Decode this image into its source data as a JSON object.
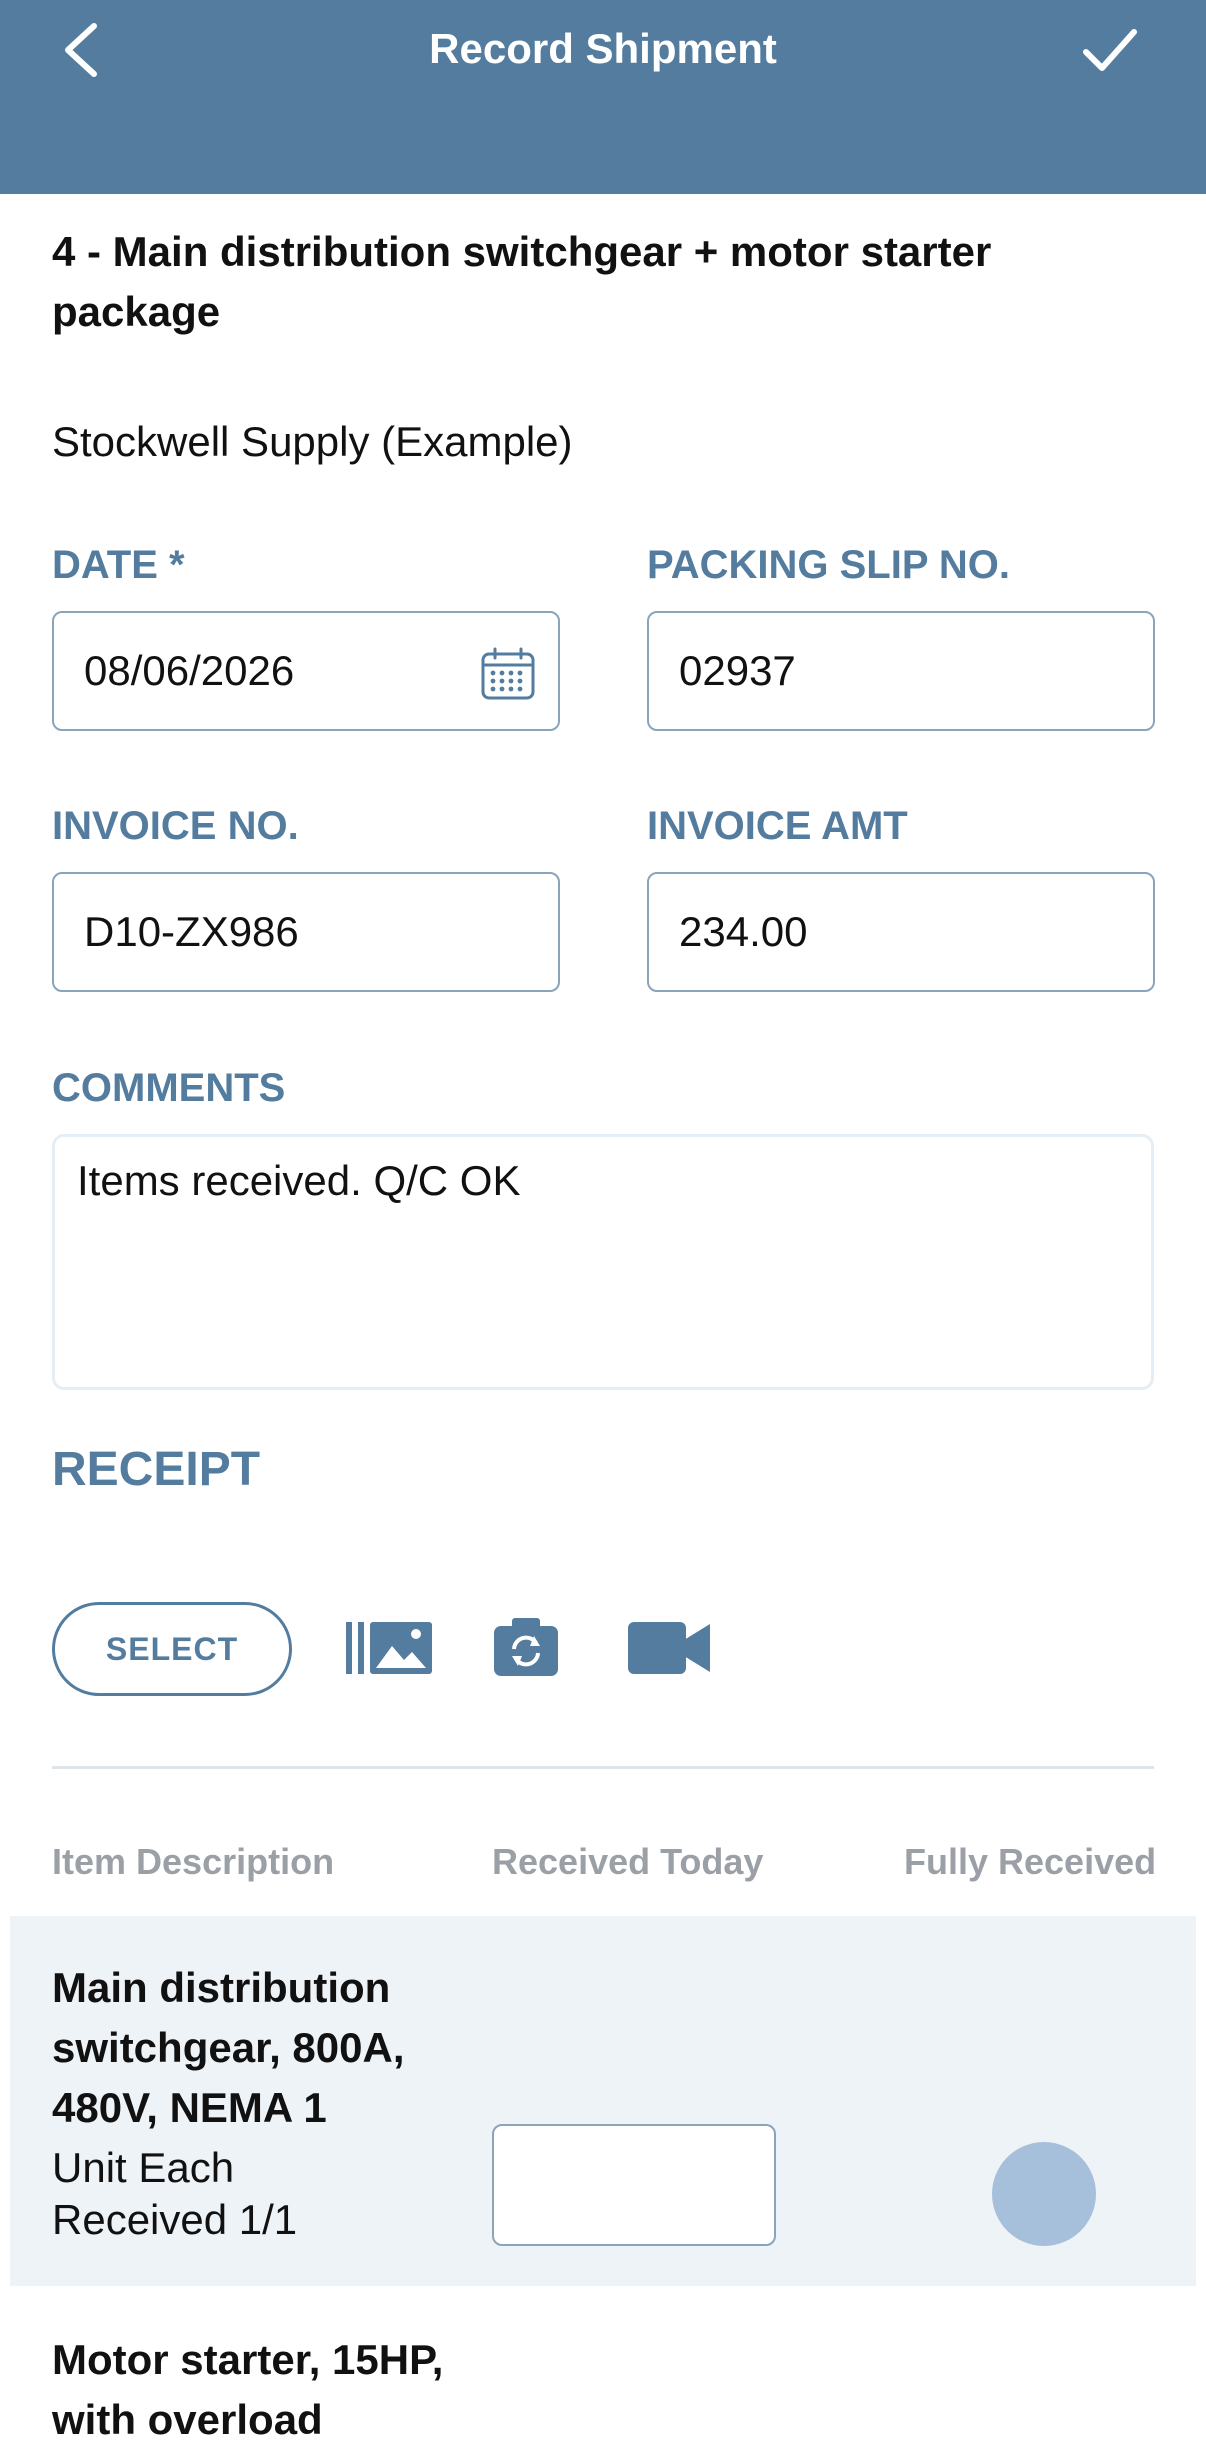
{
  "header": {
    "title": "Record Shipment",
    "back_icon": "chevron-left-icon",
    "save_icon": "check-icon",
    "background_color": "#537c9e"
  },
  "job": {
    "title": "4 - Main distribution switchgear + motor starter package",
    "vendor": "Stockwell Supply (Example)"
  },
  "form": {
    "date": {
      "label": "DATE *",
      "value": "08/06/2026"
    },
    "packing_slip": {
      "label": "PACKING SLIP NO.",
      "value": "02937"
    },
    "invoice_no": {
      "label": "INVOICE NO.",
      "value": "D10-ZX986"
    },
    "invoice_amt": {
      "label": "INVOICE AMT",
      "value": "234.00"
    },
    "comments": {
      "label": "COMMENTS",
      "value": "Items received. Q/C OK"
    }
  },
  "receipt": {
    "label": "RECEIPT",
    "select_label": "SELECT",
    "icons": [
      "gallery-icon",
      "camera-icon",
      "video-icon"
    ]
  },
  "table": {
    "columns": [
      "Item Description",
      "Received Today",
      "Fully Received"
    ],
    "rows": [
      {
        "name": "Main distribution switchgear, 800A, 480V, NEMA 1",
        "unit": "Unit Each",
        "received": "Received 1/1",
        "received_today": "",
        "highlighted": true
      },
      {
        "name": "Motor starter, 15HP, with overload"
      }
    ]
  },
  "colors": {
    "accent": "#537c9e",
    "row_highlight": "#eef3f7",
    "toggle": "#a6c0dc"
  }
}
